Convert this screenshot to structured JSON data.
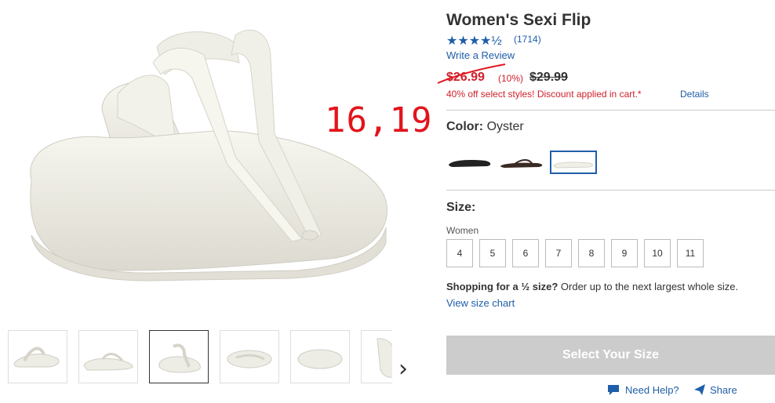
{
  "product": {
    "title": "Women's Sexi Flip",
    "stars": "★★★★½",
    "rating": 4.5,
    "review_count": "(1714)",
    "write_review": "Write a Review",
    "sale_price": "$26.99",
    "discount_pct": "(10%)",
    "original_price": "$29.99",
    "promo": "40% off select styles! Discount applied in cart.*",
    "details_link": "Details"
  },
  "annotation": {
    "text": "16,19",
    "color": "#e2141c"
  },
  "color": {
    "label": "Color:",
    "value": "Oyster",
    "swatches": [
      "black",
      "espresso",
      "oyster"
    ],
    "selected": "oyster"
  },
  "size": {
    "label": "Size:",
    "group": "Women",
    "options": [
      "4",
      "5",
      "6",
      "7",
      "8",
      "9",
      "10",
      "11"
    ],
    "half_bold": "Shopping for a ½ size?",
    "half_rest": " Order up to the next largest whole size.",
    "chart_link": "View size chart"
  },
  "cta": {
    "label": "Select Your Size"
  },
  "footer": {
    "help": "Need Help?",
    "share": "Share"
  },
  "thumbnails": {
    "count": 6,
    "active_index": 2,
    "next_icon": "chevron-right-icon"
  },
  "colors": {
    "link": "#1f5ea8",
    "sale": "#d0202a",
    "cta_disabled": "#cccccc"
  }
}
